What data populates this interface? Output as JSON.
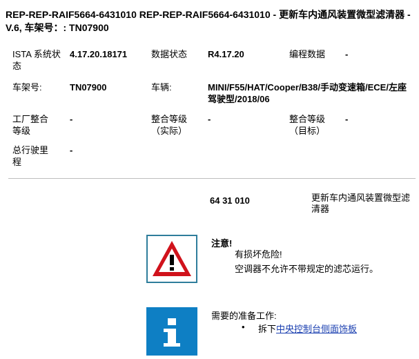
{
  "document": {
    "title": "REP-REP-RAIF5664-6431010  REP-REP-RAIF5664-6431010 - 更新车内通风装置微型滤清器 - V.6,  车架号：: TN07900"
  },
  "info": {
    "ista_label": "ISTA 系统状态",
    "ista_value": "4.17.20.18171",
    "data_status_label": "数据状态",
    "data_status_value": "R4.17.20",
    "programming_label": "编程数据",
    "programming_value": "-",
    "vin_label": "车架号:",
    "vin_value": "TN07900",
    "vehicle_label": "车辆:",
    "vehicle_value": "MINI/F55/HAT/Cooper/B38/手动变速箱/ECE/左座驾驶型/2018/06",
    "factory_level_label": "工厂整合等级",
    "factory_level_value": "-",
    "actual_level_label": "整合等级（实际）",
    "actual_level_value": "-",
    "target_level_label": "整合等级（目标）",
    "target_level_value": "-",
    "mileage_label": "总行驶里程",
    "mileage_value": "-"
  },
  "repair": {
    "number": "64 31 010",
    "description": "更新车内通风装置微型滤清器"
  },
  "warning": {
    "title": "注意!",
    "line1": "有损坏危险!",
    "line2": "空调器不允许不带规定的滤芯运行。",
    "icon": "warning-triangle-icon"
  },
  "preparation": {
    "title": "需要的准备工作:",
    "item_prefix": "拆下",
    "item_link": "中央控制台侧面饰板",
    "icon": "info-icon"
  },
  "colors": {
    "info_blue": "#0e7fc4",
    "warning_red": "#d0121b",
    "link_blue": "#1a3fb0"
  }
}
